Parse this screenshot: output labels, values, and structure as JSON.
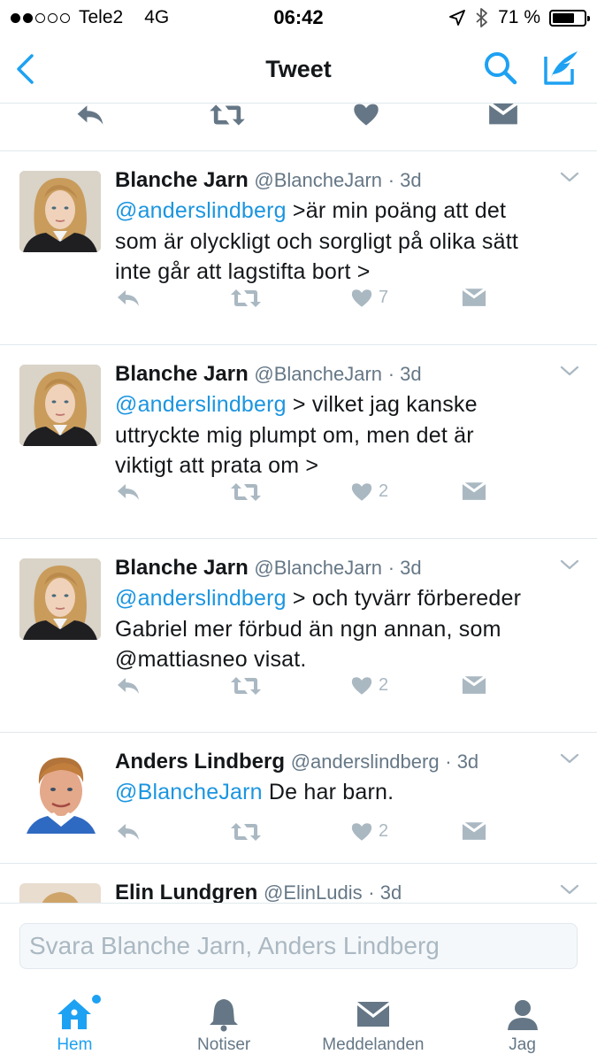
{
  "status_bar": {
    "carrier": "Tele2",
    "network": "4G",
    "time": "06:42",
    "battery": "71 %",
    "battery_level": 0.71,
    "signal_bars_filled": 2,
    "signal_bars_total": 5
  },
  "nav": {
    "title": "Tweet",
    "back_icon": "chevron-left-icon",
    "search_icon": "search-icon",
    "compose_icon": "compose-icon"
  },
  "colors": {
    "accent": "#1da1f2",
    "mention": "#1b95e0",
    "muted": "#657786",
    "action_gray": "#aab8c2",
    "divider": "#e1e8ed"
  },
  "tweets": [
    {
      "name": "Blanche Jarn",
      "handle": "@BlancheJarn",
      "time": "· 3d",
      "mention": "@anderslindberg",
      "text_lines": [
        " >är min poäng att det",
        "som är olyckligt och sorgligt på olika sätt",
        "inte går att lagstifta bort >"
      ],
      "likes": "7"
    },
    {
      "name": "Blanche Jarn",
      "handle": "@BlancheJarn",
      "time": "· 3d",
      "mention": "@anderslindberg",
      "text_lines": [
        " > vilket jag kanske",
        "uttryckte mig plumpt om, men det är",
        "viktigt att prata om >"
      ],
      "likes": "2"
    },
    {
      "name": "Blanche Jarn",
      "handle": "@BlancheJarn",
      "time": "· 3d",
      "mention": "@anderslindberg",
      "text_lines": [
        " > och tyvärr förbereder",
        "Gabriel mer förbud än ngn annan, som",
        "@mattiasneo visat."
      ],
      "likes": "2"
    },
    {
      "name": "Anders Lindberg",
      "handle": "@anderslindberg",
      "time": "· 3d",
      "mention": "@BlancheJarn",
      "text_lines": [
        " De har barn."
      ],
      "likes": "2"
    },
    {
      "name": "Elin Lundgren",
      "handle": "@ElinLudis",
      "time": "· 3d"
    }
  ],
  "reply": {
    "placeholder": "Svara Blanche Jarn, Anders Lindberg"
  },
  "tabs": [
    {
      "label": "Hem",
      "icon": "home-icon",
      "active": true,
      "has_notification": true
    },
    {
      "label": "Notiser",
      "icon": "bell-icon",
      "active": false
    },
    {
      "label": "Meddelanden",
      "icon": "envelope-icon",
      "active": false
    },
    {
      "label": "Jag",
      "icon": "person-icon",
      "active": false
    }
  ]
}
